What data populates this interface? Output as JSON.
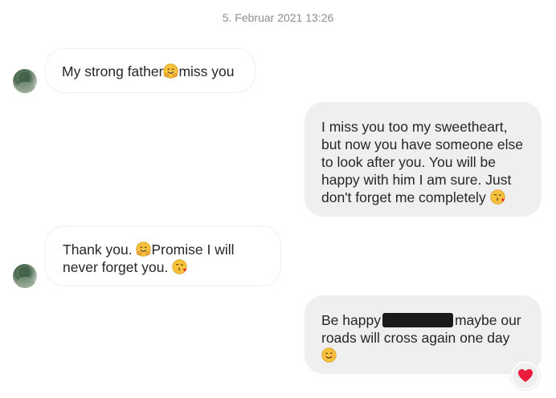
{
  "timestamp": "5. Februar 2021 13:26",
  "messages": [
    {
      "side": "incoming",
      "parts": [
        "My strong father",
        "miss you"
      ],
      "emojis": [
        "smiling-face-with-hugging-hands"
      ]
    },
    {
      "side": "outgoing",
      "text": "I miss you too my sweetheart, but now you have someone else to look after you. You will be happy with him I am sure. Just don't forget me completely",
      "emojis": [
        "face-blowing-kiss"
      ]
    },
    {
      "side": "incoming",
      "parts": [
        "Thank you.",
        "Promise I will never forget you."
      ],
      "emojis": [
        "smiling-face-with-hugging-hands",
        "face-blowing-kiss"
      ]
    },
    {
      "side": "outgoing",
      "parts": [
        "Be happy",
        "maybe our roads will cross again one day"
      ],
      "emojis": [
        "smiling-face-with-smiling-eyes"
      ],
      "reaction": "red-heart"
    }
  ],
  "colors": {
    "incoming_bg": "#ffffff",
    "incoming_border": "#efefef",
    "outgoing_bg": "#efefef",
    "timestamp": "#8e8e8e",
    "text": "#262626",
    "heart": "#ed1c3a",
    "emoji_yellow": "#f9c23c"
  }
}
